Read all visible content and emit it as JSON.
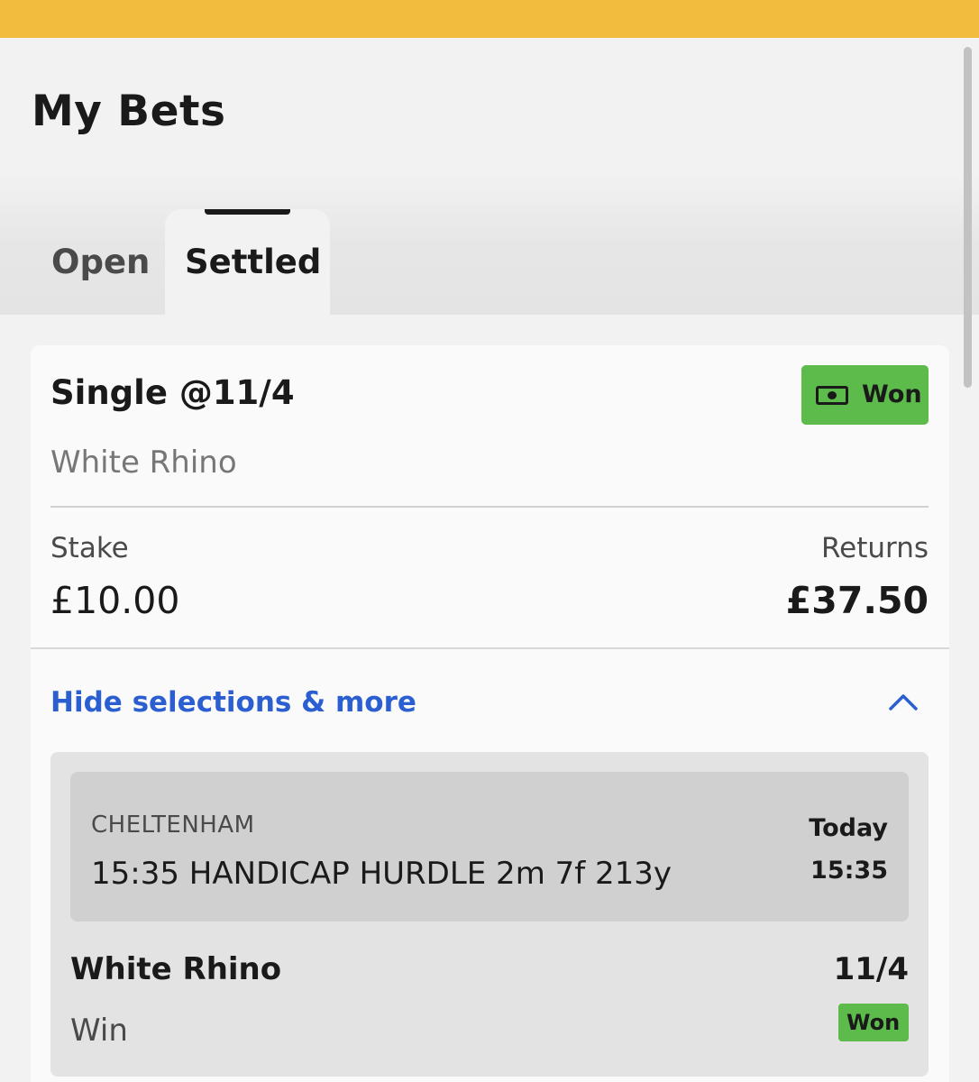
{
  "page": {
    "title": "My Bets"
  },
  "tabs": [
    {
      "label": "Open",
      "active": false
    },
    {
      "label": "Settled",
      "active": true
    }
  ],
  "bet": {
    "type_label": "Single @11/4",
    "status": "Won",
    "status_icon": "cash-icon",
    "selection": "White Rhino",
    "stake_label": "Stake",
    "stake_value": "£10.00",
    "returns_label": "Returns",
    "returns_value": "£37.50",
    "toggle_label": "Hide selections & more",
    "toggle_icon": "chevron-up-icon",
    "details": {
      "venue": "CHELTENHAM",
      "race": "15:35 HANDICAP HURDLE 2m 7f 213y",
      "day": "Today",
      "time": "15:35",
      "horse": "White Rhino",
      "odds": "11/4",
      "market": "Win",
      "result": "Won"
    }
  },
  "colors": {
    "accent_bar": "#f2bd3f",
    "won_badge": "#5cbb4a",
    "link": "#2b5fd1"
  }
}
